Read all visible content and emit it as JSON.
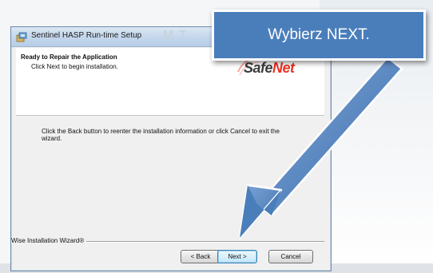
{
  "window": {
    "title": "Sentinel HASP Run-time Setup",
    "title_ghost": "M T"
  },
  "header": {
    "title": "Ready to Repair the Application",
    "subtitle": "Click Next to begin installation.",
    "logo_prefix": "Safe",
    "logo_suffix": "Net",
    "logo_suffix_color": "#ee3124"
  },
  "body": {
    "text": "Click the Back button to reenter the installation information or click Cancel to exit the wizard."
  },
  "footer": {
    "wizard_label": "Wise Installation Wizard®"
  },
  "buttons": {
    "back": "< Back",
    "next": "Next >",
    "cancel": "Cancel"
  },
  "callout": {
    "text": "Wybierz NEXT.",
    "color": "#4a7ebb"
  }
}
